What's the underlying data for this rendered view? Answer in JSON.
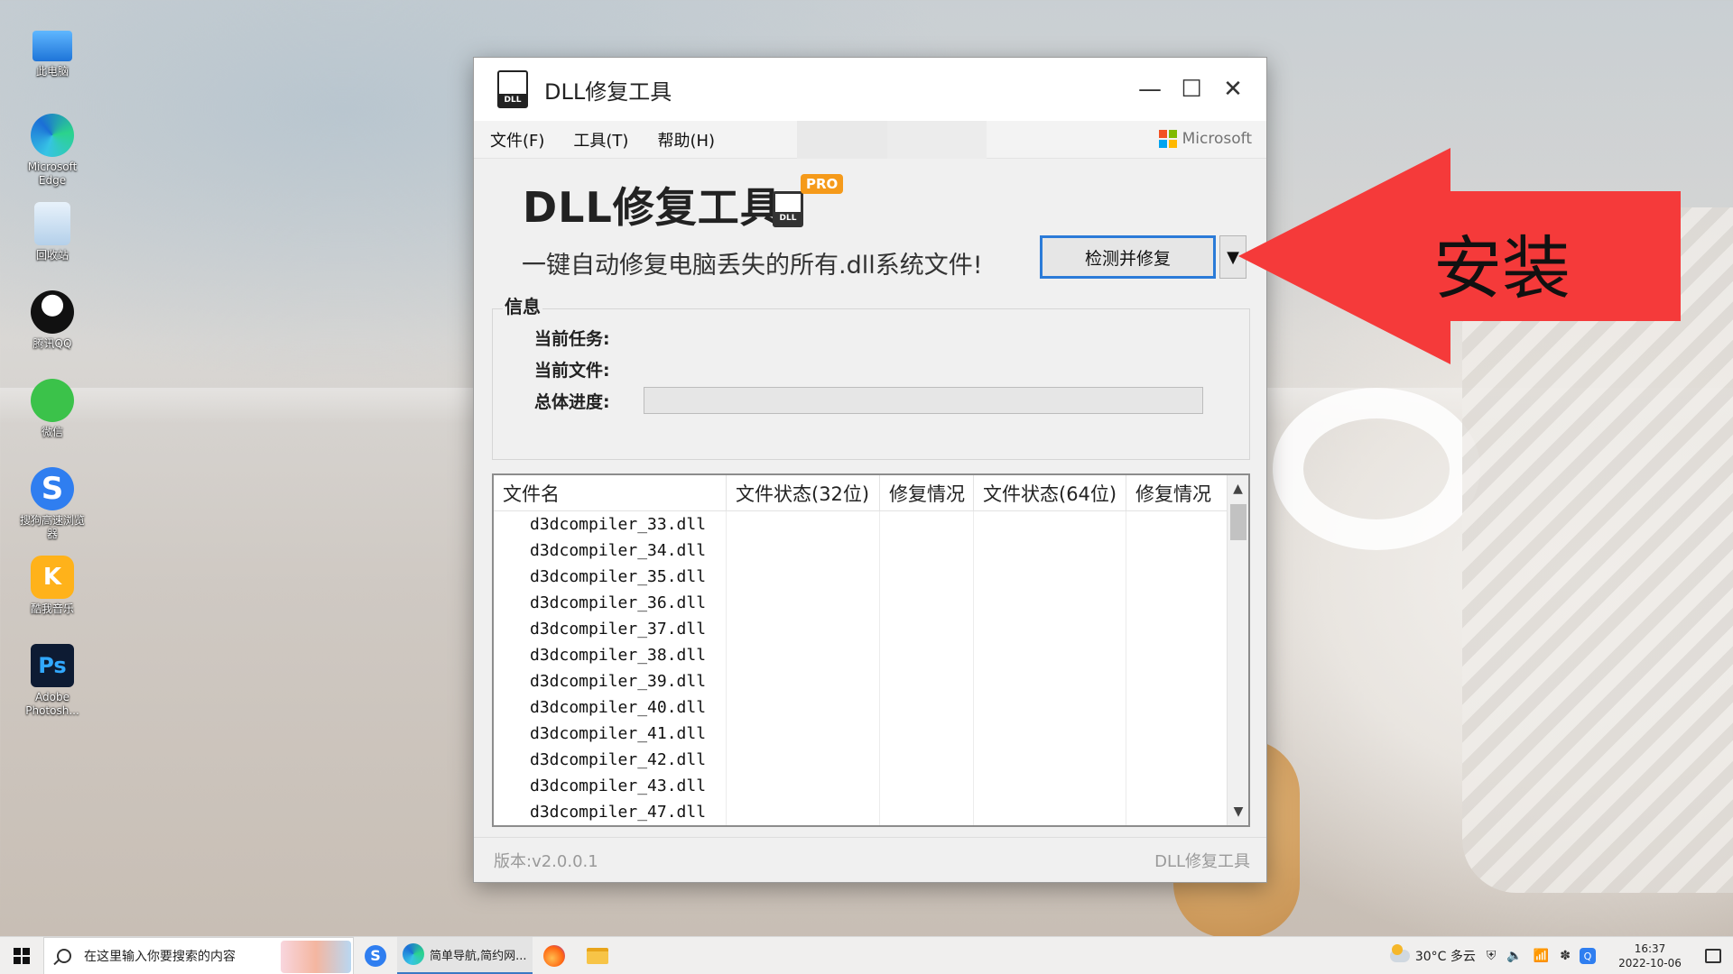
{
  "desktop": {
    "icons": [
      {
        "label": "此电脑",
        "icon": "computer-icon"
      },
      {
        "label": "Microsoft Edge",
        "icon": "edge-icon"
      },
      {
        "label": "回收站",
        "icon": "recycle-bin-icon"
      },
      {
        "label": "腾讯QQ",
        "icon": "qq-icon"
      },
      {
        "label": "微信",
        "icon": "wechat-icon"
      },
      {
        "label": "搜狗高速浏览器",
        "icon": "sogou-browser-icon"
      },
      {
        "label": "酷我音乐",
        "icon": "kuwo-music-icon"
      },
      {
        "label": "Adobe Photosh...",
        "icon": "photoshop-icon"
      }
    ]
  },
  "window": {
    "title": "DLL修复工具",
    "icon_tag": "DLL",
    "controls": {
      "minimize": "—",
      "maximize": "☐",
      "close": "✕"
    },
    "menu": [
      "文件(F)",
      "工具(T)",
      "帮助(H)"
    ],
    "brand": "Microsoft",
    "hero_title": "DLL修复工具",
    "pro_badge": "PRO",
    "subtitle": "一键自动修复电脑丢失的所有.dll系统文件!",
    "scan_button": "检测并修复",
    "dropdown_glyph": "▼",
    "info": {
      "legend": "信息",
      "current_task_label": "当前任务:",
      "current_file_label": "当前文件:",
      "overall_progress_label": "总体进度:",
      "progress": 0
    },
    "table": {
      "columns": [
        "文件名",
        "文件状态(32位)",
        "修复情况",
        "文件状态(64位)",
        "修复情况"
      ],
      "rows": [
        "d3dcompiler_33.dll",
        "d3dcompiler_34.dll",
        "d3dcompiler_35.dll",
        "d3dcompiler_36.dll",
        "d3dcompiler_37.dll",
        "d3dcompiler_38.dll",
        "d3dcompiler_39.dll",
        "d3dcompiler_40.dll",
        "d3dcompiler_41.dll",
        "d3dcompiler_42.dll",
        "d3dcompiler_43.dll",
        "d3dcompiler_47.dll"
      ]
    },
    "footer": {
      "version": "版本:v2.0.0.1",
      "product": "DLL修复工具"
    }
  },
  "callout": {
    "text": "安装",
    "color": "#f53a3a"
  },
  "taskbar": {
    "search_placeholder": "在这里输入你要搜索的内容",
    "edge_task_title": "简单导航,简约网...",
    "weather": "30°C 多云",
    "time": "16:37",
    "date": "2022-10-06"
  },
  "colors": {
    "accent": "#2b7bd8",
    "badge": "#f59a1a"
  }
}
